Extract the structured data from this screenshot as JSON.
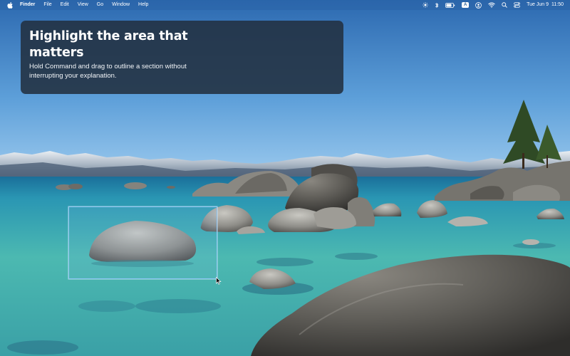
{
  "menubar": {
    "app_name": "Finder",
    "menus": [
      "File",
      "Edit",
      "View",
      "Go",
      "Window",
      "Help"
    ],
    "status_icons": [
      "brightness-icon",
      "bluetooth-icon",
      "battery-icon",
      "input-source-icon",
      "user-icon",
      "wifi-icon",
      "search-icon",
      "control-center-icon"
    ],
    "input_source_label": "A",
    "clock": {
      "date": "Tue Jun 9",
      "time": "11:50"
    }
  },
  "tip": {
    "title": "Highlight the area that matters",
    "body": "Hold Command and drag to outline a section without interrupting your explanation."
  },
  "colors": {
    "sky_top": "#2f6fb5",
    "sky_horizon": "#8cc0ea",
    "water_shallow": "#3fb2ad",
    "selection_border": "#8fc6f5",
    "card_bg": "#223040"
  }
}
